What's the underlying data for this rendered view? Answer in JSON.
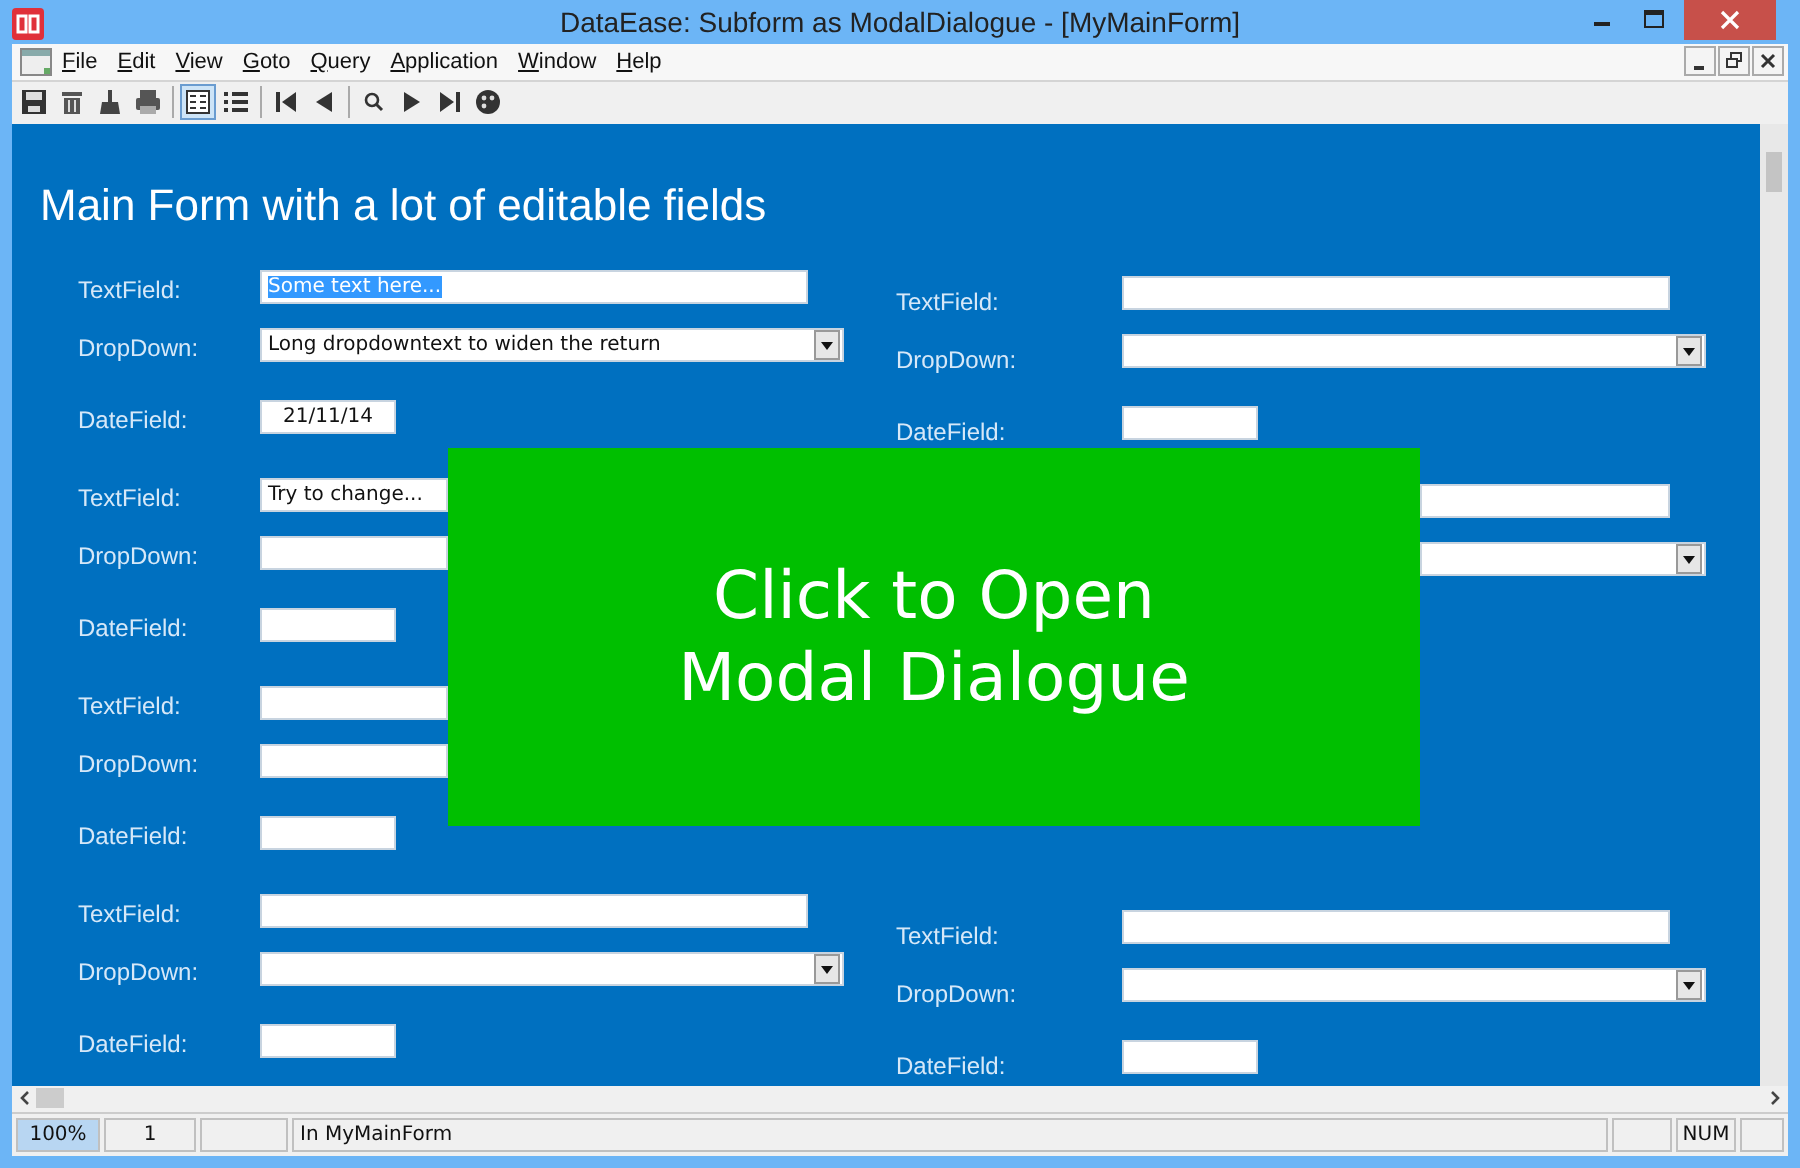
{
  "window": {
    "title": "DataEase: Subform as ModalDialogue - [MyMainForm]"
  },
  "menu": [
    "File",
    "Edit",
    "View",
    "Goto",
    "Query",
    "Application",
    "Window",
    "Help"
  ],
  "toolbar": [
    {
      "kind": "save",
      "selected": false
    },
    {
      "kind": "delete",
      "selected": false
    },
    {
      "kind": "clear",
      "selected": false
    },
    {
      "kind": "print",
      "selected": false
    },
    {
      "kind": "sep"
    },
    {
      "kind": "form",
      "selected": true
    },
    {
      "kind": "list",
      "selected": false
    },
    {
      "kind": "sep"
    },
    {
      "kind": "first",
      "selected": false
    },
    {
      "kind": "prev",
      "selected": false
    },
    {
      "kind": "sep"
    },
    {
      "kind": "search",
      "selected": false
    },
    {
      "kind": "next",
      "selected": false
    },
    {
      "kind": "last",
      "selected": false
    },
    {
      "kind": "palette",
      "selected": false
    }
  ],
  "form": {
    "title": "Main Form with a lot of editable fields",
    "left_groups": [
      {
        "rows": [
          {
            "label": "TextField:",
            "kind": "text",
            "value": "Some text here...",
            "text_selected": true
          },
          {
            "label": "DropDown:",
            "kind": "dropdown",
            "value": "Long dropdowntext to widen the return"
          },
          {
            "label": "DateField:",
            "kind": "date",
            "value": "21/11/14"
          }
        ]
      },
      {
        "rows": [
          {
            "label": "TextField:",
            "kind": "text",
            "value": "Try to change..."
          },
          {
            "label": "DropDown:",
            "kind": "dropdown"
          },
          {
            "label": "DateField:",
            "kind": "date"
          }
        ]
      },
      {
        "rows": [
          {
            "label": "TextField:",
            "kind": "text"
          },
          {
            "label": "DropDown:",
            "kind": "dropdown"
          },
          {
            "label": "DateField:",
            "kind": "date"
          }
        ]
      },
      {
        "rows": [
          {
            "label": "TextField:",
            "kind": "text"
          },
          {
            "label": "DropDown:",
            "kind": "dropdown"
          },
          {
            "label": "DateField:",
            "kind": "date"
          }
        ]
      }
    ],
    "right_groups": [
      {
        "rows": [
          {
            "label": "TextField:",
            "kind": "text"
          },
          {
            "label": "DropDown:",
            "kind": "dropdown"
          },
          {
            "label": "DateField:",
            "kind": "date"
          }
        ]
      },
      {
        "rows": [
          {
            "kind": "text"
          },
          {
            "kind": "dropdown"
          }
        ]
      },
      {
        "rows": [
          {
            "label": "TextField:",
            "kind": "text"
          },
          {
            "label": "DropDown:",
            "kind": "dropdown"
          },
          {
            "label": "DateField:",
            "kind": "date"
          }
        ]
      }
    ],
    "open_button": {
      "lines": [
        "Click to Open",
        "Modal Dialogue"
      ]
    }
  },
  "status_bar": [
    {
      "text": "100%",
      "selected": true
    },
    {
      "text": "1",
      "selected": false
    },
    {
      "selected": false
    },
    {
      "text": "In MyMainForm",
      "selected": false
    },
    {
      "selected": false
    },
    {
      "text": "NUM",
      "selected": false
    },
    {
      "selected": false
    }
  ]
}
